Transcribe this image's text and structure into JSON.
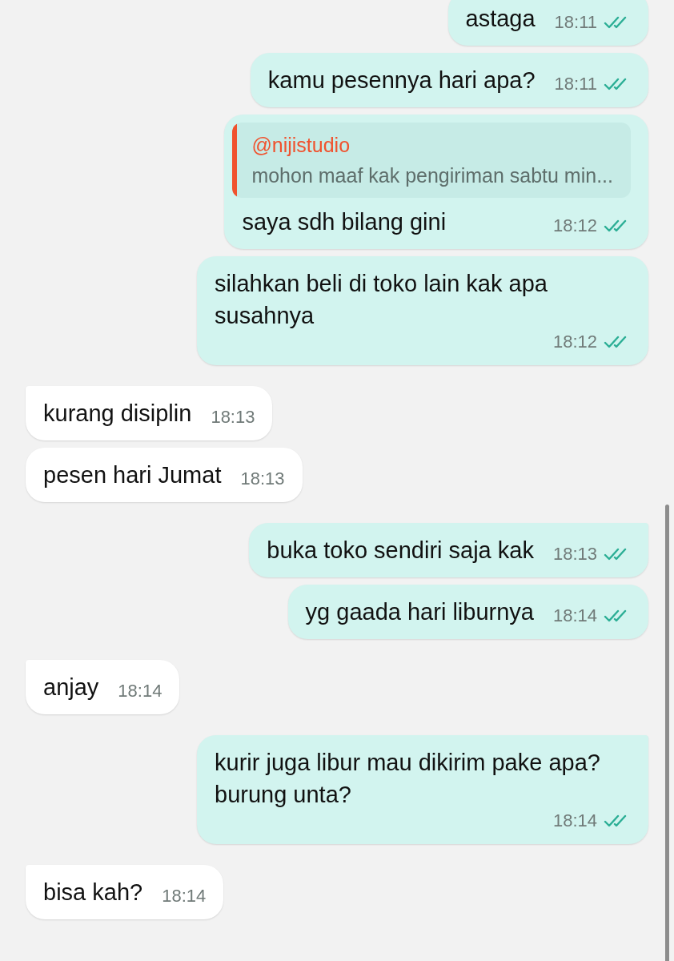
{
  "messages": [
    {
      "kind": "out",
      "text": "astaga",
      "time": "18:11",
      "tail": false
    },
    {
      "kind": "out",
      "text": "kamu pesennya hari apa?",
      "time": "18:11",
      "tail": false
    },
    {
      "kind": "out",
      "text": "saya sdh bilang gini",
      "time": "18:12",
      "tail": false,
      "quote": {
        "author": "@nijistudio",
        "text": "mohon maaf kak pengiriman sabtu min..."
      }
    },
    {
      "kind": "out",
      "text": "silahkan beli di toko lain kak apa susahnya",
      "time": "18:12",
      "tail": false
    },
    {
      "kind": "in",
      "text": "kurang disiplin",
      "time": "18:13",
      "tail": true
    },
    {
      "kind": "in",
      "text": "pesen hari Jumat",
      "time": "18:13",
      "tail": false
    },
    {
      "kind": "out",
      "text": "buka toko sendiri saja kak",
      "time": "18:13",
      "tail": true
    },
    {
      "kind": "out",
      "text": "yg gaada hari liburnya",
      "time": "18:14",
      "tail": false
    },
    {
      "kind": "in",
      "text": "anjay",
      "time": "18:14",
      "tail": true
    },
    {
      "kind": "out",
      "text": "kurir juga libur mau dikirim pake apa? burung unta?",
      "time": "18:14",
      "tail": true
    },
    {
      "kind": "in",
      "text": "bisa kah?",
      "time": "18:14",
      "tail": true
    }
  ]
}
